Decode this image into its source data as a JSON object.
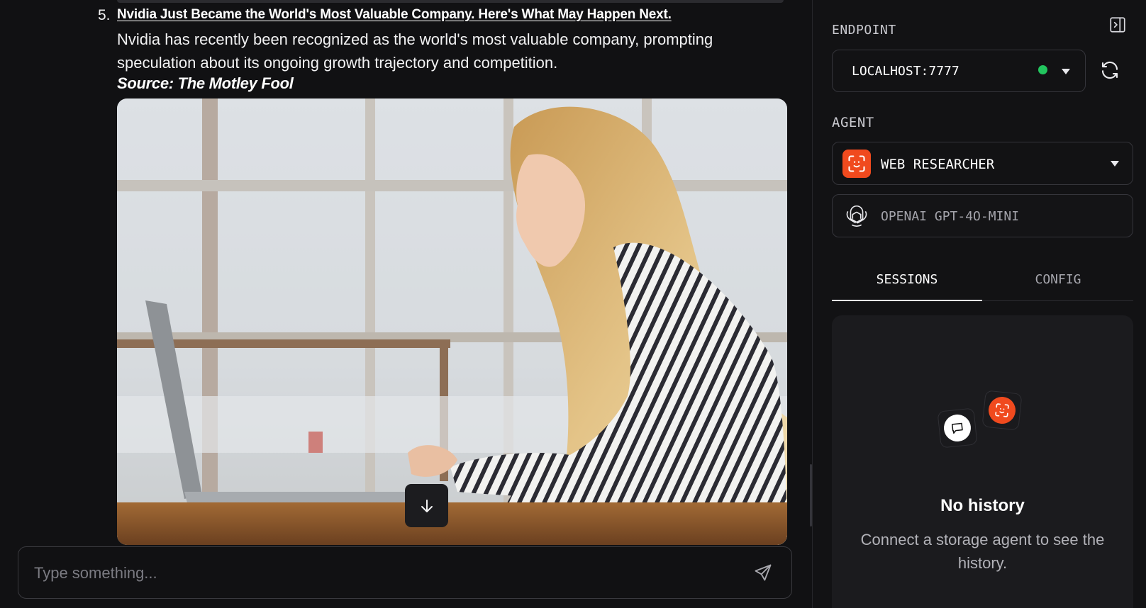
{
  "chat": {
    "item_number": "5.",
    "item_title": "Nvidia Just Became the World's Most Valuable Company. Here's What May Happen Next.",
    "item_description": "Nvidia has recently been recognized as the world's most valuable company, prompting speculation about its ongoing growth trajectory and competition.",
    "item_source": "Source: The Motley Fool",
    "image_alt": "Woman working on a laptop",
    "composer_placeholder": "Type something..."
  },
  "panel": {
    "endpoint_label": "ENDPOINT",
    "endpoint_value": "LOCALHOST:7777",
    "endpoint_status_color": "#22c55e",
    "agent_label": "AGENT",
    "agent_name": "WEB RESEARCHER",
    "agent_icon_color": "#f04a1e",
    "model_name": "OPENAI GPT-4O-MINI",
    "tabs": [
      {
        "label": "SESSIONS",
        "active": true
      },
      {
        "label": "CONFIG",
        "active": false
      }
    ],
    "history_title": "No history",
    "history_subtitle": "Connect a storage agent to see the history."
  }
}
